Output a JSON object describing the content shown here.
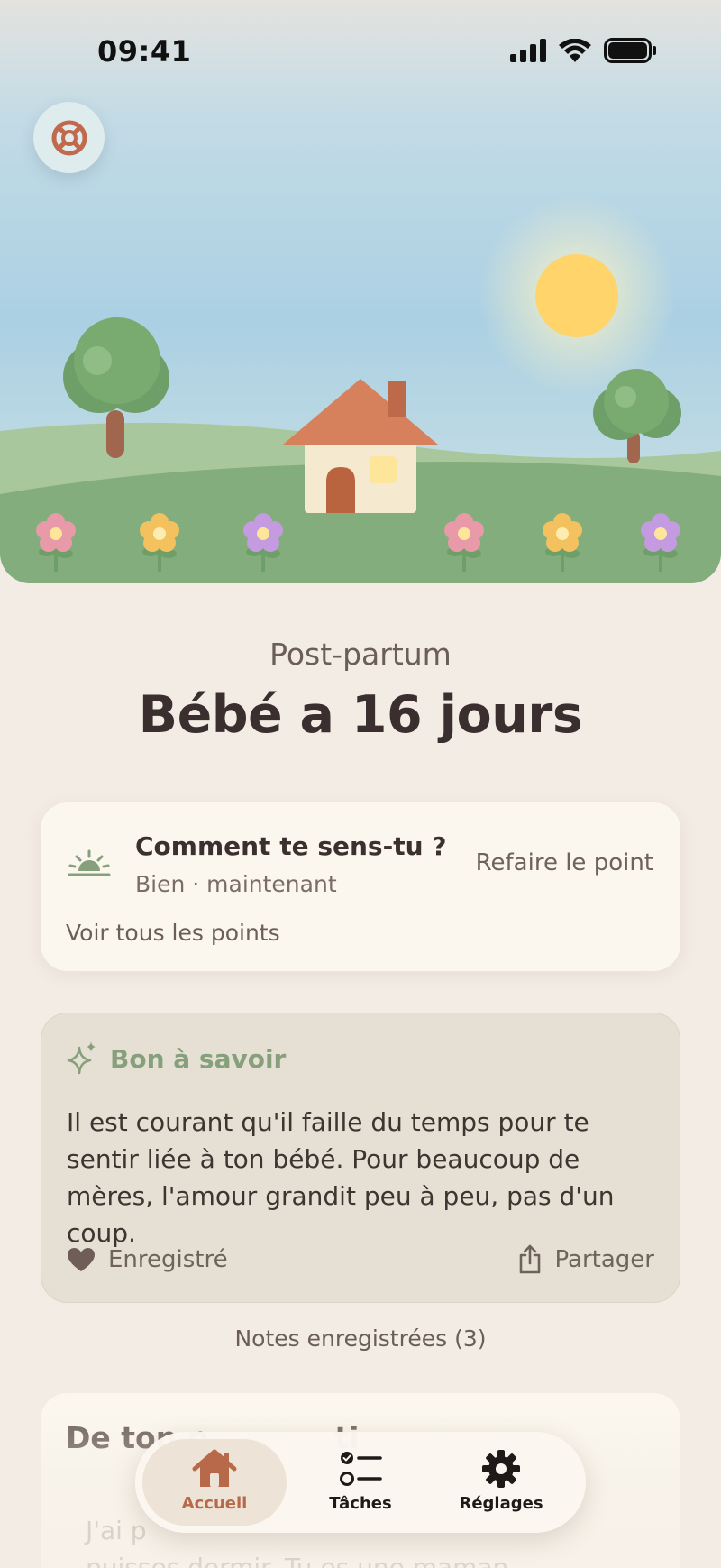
{
  "status_bar": {
    "time": "09:41"
  },
  "header": {
    "phase": "Post-partum",
    "headline": "Bébé a 16 jours"
  },
  "checkin": {
    "title": "Comment te sens-tu ?",
    "subtitle": "Bien · maintenant",
    "redo_label": "Refaire le point",
    "all_label": "Voir tous les points"
  },
  "tip": {
    "title": "Bon à savoir",
    "body": "Il est courant qu'il faille du temps pour te sentir liée à ton bébé. Pour beaucoup de mères, l'amour grandit peu à peu, pas d'un coup.",
    "saved_label": "Enregistré",
    "share_label": "Partager"
  },
  "saved_notes_label": "Notes enregistrées (3)",
  "partner": {
    "title": "De ton p",
    "title_tail": "ti",
    "body_line1": "J'ai p",
    "body_line2": "puisses dormir. Tu es une maman"
  },
  "tabbar": {
    "tabs": [
      {
        "label": "Accueil",
        "icon": "house-icon",
        "active": true
      },
      {
        "label": "Tâches",
        "icon": "checklist-icon",
        "active": false
      },
      {
        "label": "Réglages",
        "icon": "gear-icon",
        "active": false
      }
    ]
  },
  "colors": {
    "background": "#f3ece4",
    "accent": "#b8694a",
    "tip_title": "#86a07c",
    "card": "#fbf7ee"
  }
}
